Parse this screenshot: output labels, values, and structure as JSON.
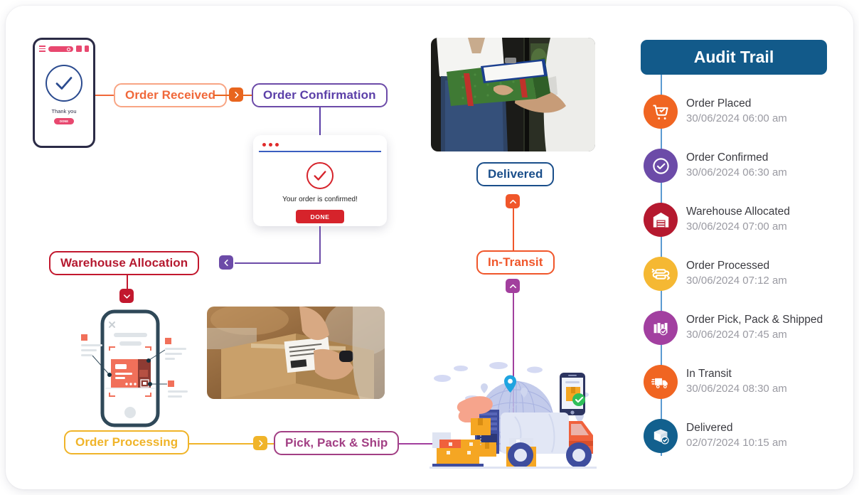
{
  "audit": {
    "title": "Audit Trail",
    "header_color": "#125A8A",
    "spine_color": "#5b9bd1",
    "items": [
      {
        "icon": "shopping-cart-icon",
        "label": "Order Placed",
        "time": "30/06/2024 06:00 am",
        "color": "#F06522"
      },
      {
        "icon": "check-circle-icon",
        "label": "Order Confirmed",
        "time": "30/06/2024 06:30 am",
        "color": "#6C4BA8"
      },
      {
        "icon": "warehouse-icon",
        "label": "Warehouse Allocated",
        "time": "30/06/2024 07:00 am",
        "color": "#B5192F"
      },
      {
        "icon": "conveyor-icon",
        "label": "Order Processed",
        "time": "30/06/2024 07:12 am",
        "color": "#F5B833"
      },
      {
        "icon": "pack-ship-icon",
        "label": "Order Pick, Pack & Shipped",
        "time": "30/06/2024 07:45 am",
        "color": "#A23FA0"
      },
      {
        "icon": "truck-icon",
        "label": "In Transit",
        "time": "30/06/2024 08:30 am",
        "color": "#F06522"
      },
      {
        "icon": "delivered-box-icon",
        "label": "Delivered",
        "time": "02/07/2024 10:15 am",
        "color": "#12608E"
      }
    ]
  },
  "flow": {
    "nodes": [
      {
        "id": "order-received",
        "label": "Order Received",
        "color": "#F0683A"
      },
      {
        "id": "order-confirmation",
        "label": "Order Confirmation",
        "color": "#5B3FA8"
      },
      {
        "id": "warehouse-allocation",
        "label": "Warehouse Allocation",
        "color": "#B5192F"
      },
      {
        "id": "order-processing",
        "label": "Order Processing",
        "color": "#F0B429"
      },
      {
        "id": "pick-pack-ship",
        "label": "Pick, Pack & Ship",
        "color": "#A23F84"
      },
      {
        "id": "in-transit",
        "label": "In-Transit",
        "color": "#F0562A"
      },
      {
        "id": "delivered",
        "label": "Delivered",
        "color": "#1A4E8A"
      }
    ],
    "badges": [
      {
        "id": "badge-order-received-right",
        "direction": "right",
        "color": "#E8651E"
      },
      {
        "id": "badge-confirmation-left",
        "direction": "left",
        "color": "#6C4BA8"
      },
      {
        "id": "badge-warehouse-down",
        "direction": "down",
        "color": "#C2182E"
      },
      {
        "id": "badge-processing-right",
        "direction": "right",
        "color": "#F0B429"
      },
      {
        "id": "badge-in-transit-up",
        "direction": "up",
        "color": "#F0562A"
      },
      {
        "id": "badge-pick-pack-up",
        "direction": "up",
        "color": "#A23F9E"
      }
    ]
  },
  "phone_mockup": {
    "thanks_text": "Thank you",
    "done_label": "DONE",
    "accent_color": "#e8486f",
    "check_color": "#2b4b8f"
  },
  "dialog": {
    "message": "Your order is confirmed!",
    "done_label": "DONE",
    "accent_color": "#d6232b",
    "rule_color": "#3a5ec0"
  },
  "photos": {
    "delivery_handoff": "delivery-handoff-photo",
    "packing_label": "packing-label-photo"
  },
  "illustrations": {
    "scan_phone": "barcode-scan-phone-illustration",
    "delivery_truck": "delivery-truck-illustration"
  }
}
